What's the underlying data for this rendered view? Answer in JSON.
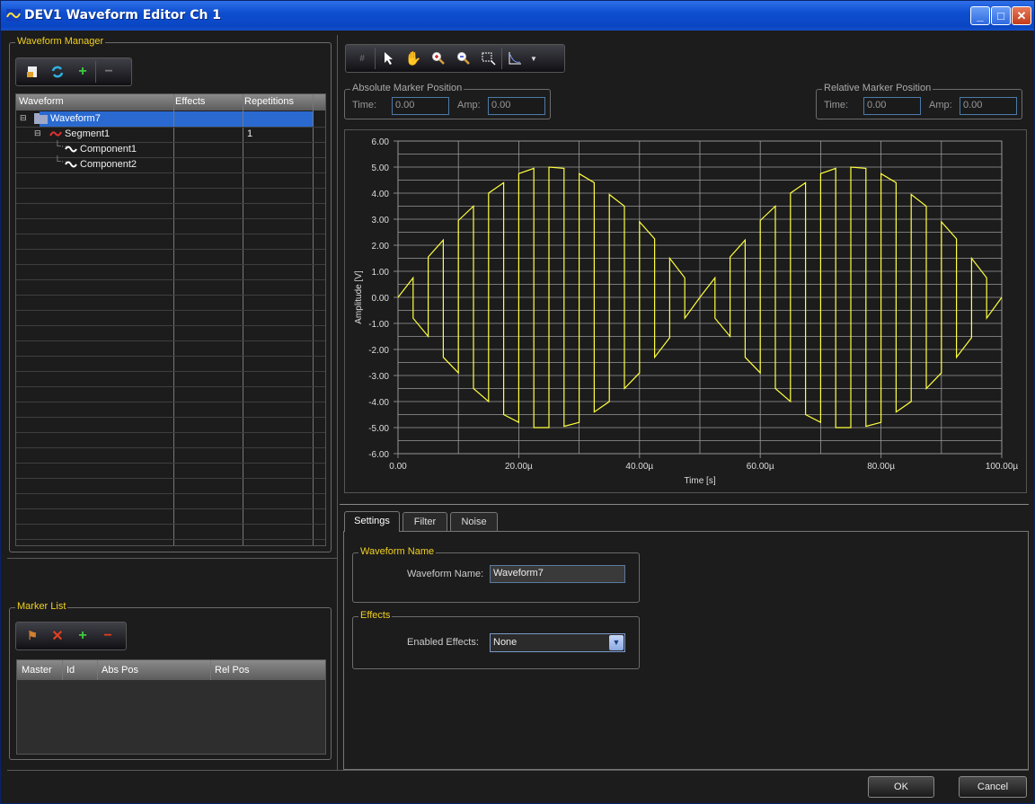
{
  "window": {
    "title": "DEV1 Waveform Editor Ch 1",
    "minimize": "_",
    "maximize": "□",
    "close": "✕"
  },
  "waveform_manager": {
    "legend": "Waveform Manager",
    "toolbar_icons": [
      "import-icon",
      "refresh-icon",
      "add-icon",
      "remove-icon"
    ],
    "columns": [
      "Waveform",
      "Effects",
      "Repetitions"
    ],
    "rows": [
      {
        "name": "Waveform7",
        "effects": "",
        "repetitions": "",
        "level": 0,
        "selected": true
      },
      {
        "name": "Segment1",
        "effects": "",
        "repetitions": "1",
        "level": 1,
        "selected": false
      },
      {
        "name": "Component1",
        "effects": "",
        "repetitions": "",
        "level": 2,
        "selected": false
      },
      {
        "name": "Component2",
        "effects": "",
        "repetitions": "",
        "level": 2,
        "selected": false
      }
    ]
  },
  "marker_list": {
    "legend": "Marker List",
    "toolbar_icons": [
      "marker-icon",
      "delete-icon",
      "add-icon",
      "remove-icon"
    ],
    "columns": [
      "Master",
      "Id",
      "Abs Pos",
      "Rel Pos"
    ]
  },
  "plot_toolbar": {
    "icons": [
      "grid-icon",
      "pointer-icon",
      "pan-hand-icon",
      "zoom-in-icon",
      "zoom-out-icon",
      "zoom-box-icon",
      "chart-type-icon",
      "dropdown-arrow-icon"
    ]
  },
  "absolute_marker": {
    "legend": "Absolute Marker Position",
    "time_label": "Time:",
    "time_value": "0.00",
    "amp_label": "Amp:",
    "amp_value": "0.00"
  },
  "relative_marker": {
    "legend": "Relative Marker Position",
    "time_label": "Time:",
    "time_value": "0.00",
    "amp_label": "Amp:",
    "amp_value": "0.00"
  },
  "chart_data": {
    "type": "line",
    "xlabel": "Time [s]",
    "ylabel": "Amplitude [V]",
    "xlim": [
      0,
      100
    ],
    "ylim": [
      -6,
      6
    ],
    "x_ticks": [
      "0.00",
      "20.00µ",
      "40.00µ",
      "60.00µ",
      "80.00µ",
      "100.00µ"
    ],
    "y_ticks": [
      "6.00",
      "5.00",
      "4.00",
      "3.00",
      "2.00",
      "1.00",
      "0.00",
      "-1.00",
      "-2.00",
      "-3.00",
      "-4.00",
      "-5.00",
      "-6.00"
    ],
    "grid": true,
    "series": [
      {
        "color": "#ffff40",
        "x": [
          0,
          2.5,
          2.5,
          5,
          5,
          7.5,
          7.5,
          10,
          10,
          12.5,
          12.5,
          15,
          15,
          17.5,
          17.5,
          20,
          20,
          22.5,
          22.5,
          25,
          25,
          27.5,
          27.5,
          30,
          30,
          32.5,
          32.5,
          35,
          35,
          37.5,
          37.5,
          40,
          40,
          42.5,
          42.5,
          45,
          45,
          47.5,
          47.5,
          50,
          50,
          52.5,
          52.5,
          55,
          55,
          57.5,
          57.5,
          60,
          60,
          62.5,
          62.5,
          65,
          65,
          67.5,
          67.5,
          70,
          70,
          72.5,
          72.5,
          75,
          75,
          77.5,
          77.5,
          80,
          80,
          82.5,
          82.5,
          85,
          85,
          87.5,
          87.5,
          90,
          90,
          92.5,
          92.5,
          95,
          95,
          97.5,
          97.5,
          100
        ],
        "y": [
          0,
          0.75,
          -0.8,
          -1.5,
          1.55,
          2.2,
          -2.3,
          -2.9,
          2.95,
          3.5,
          -3.5,
          -4.0,
          4.0,
          4.4,
          -4.5,
          -4.8,
          4.75,
          4.95,
          -5.0,
          -5.0,
          5.0,
          4.95,
          -4.95,
          -4.8,
          4.75,
          4.4,
          -4.4,
          -4.0,
          3.95,
          3.5,
          -3.5,
          -2.9,
          2.9,
          2.25,
          -2.3,
          -1.55,
          1.5,
          0.75,
          -0.8,
          0,
          0,
          0.75,
          -0.8,
          -1.5,
          1.55,
          2.2,
          -2.3,
          -2.9,
          2.95,
          3.5,
          -3.5,
          -4.0,
          4.0,
          4.4,
          -4.5,
          -4.8,
          4.75,
          4.95,
          -5.0,
          -5.0,
          5.0,
          4.95,
          -4.95,
          -4.8,
          4.75,
          4.4,
          -4.4,
          -4.0,
          3.95,
          3.5,
          -3.5,
          -2.9,
          2.9,
          2.25,
          -2.3,
          -1.55,
          1.5,
          0.75,
          -0.8,
          0
        ]
      }
    ]
  },
  "tabs": [
    "Settings",
    "Filter",
    "Noise"
  ],
  "settings": {
    "name_legend": "Waveform Name",
    "name_label": "Waveform Name:",
    "name_value": "Waveform7",
    "effects_legend": "Effects",
    "effects_label": "Enabled Effects:",
    "effects_value": "None"
  },
  "footer": {
    "ok": "OK",
    "cancel": "Cancel"
  }
}
